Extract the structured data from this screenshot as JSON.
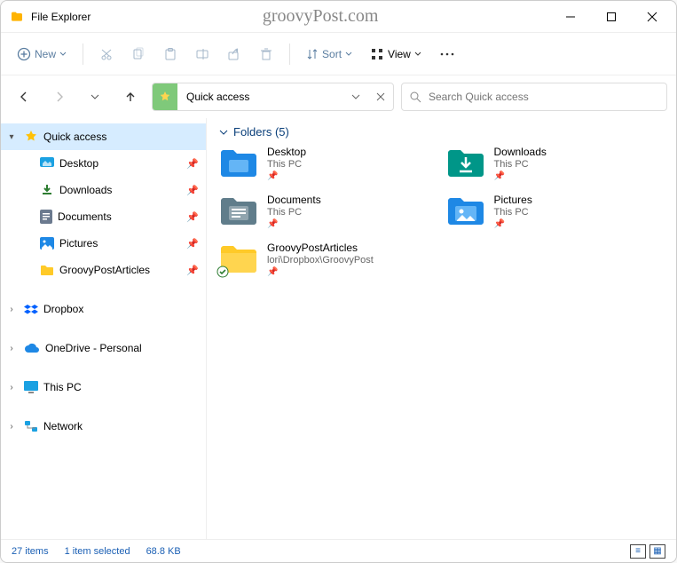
{
  "window": {
    "title": "File Explorer",
    "watermark": "groovyPost.com"
  },
  "toolbar": {
    "new_label": "New",
    "sort_label": "Sort",
    "view_label": "View"
  },
  "address": {
    "path_label": "Quick access",
    "search_placeholder": "Search Quick access"
  },
  "sidebar": {
    "quick": "Quick access",
    "desktop": "Desktop",
    "downloads": "Downloads",
    "documents": "Documents",
    "pictures": "Pictures",
    "groovy": "GroovyPostArticles",
    "dropbox": "Dropbox",
    "onedrive": "OneDrive - Personal",
    "thispc": "This PC",
    "network": "Network"
  },
  "group": {
    "label": "Folders (5)"
  },
  "folders": {
    "desktop": {
      "name": "Desktop",
      "loc": "This PC"
    },
    "downloads": {
      "name": "Downloads",
      "loc": "This PC"
    },
    "documents": {
      "name": "Documents",
      "loc": "This PC"
    },
    "pictures": {
      "name": "Pictures",
      "loc": "This PC"
    },
    "groovy": {
      "name": "GroovyPostArticles",
      "loc": "lori\\Dropbox\\GroovyPost"
    }
  },
  "status": {
    "count": "27 items",
    "selected": "1 item selected",
    "size": "68.8 KB"
  }
}
